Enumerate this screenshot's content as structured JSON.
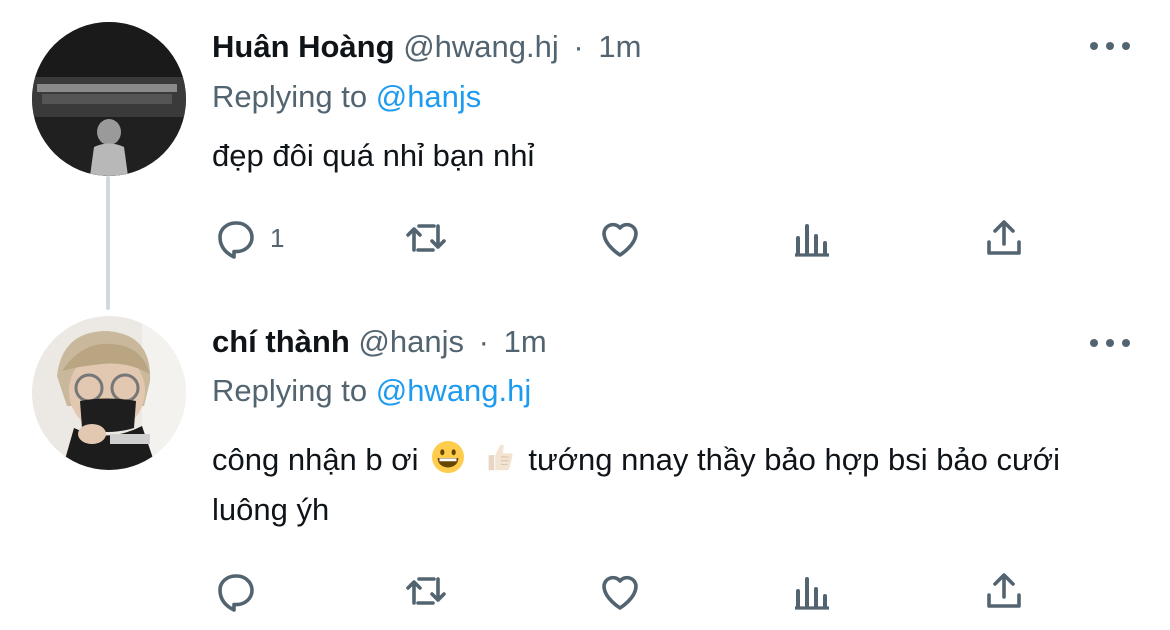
{
  "tweets": [
    {
      "name": "Huân Hoàng",
      "handle": "@hwang.hj",
      "separator": "·",
      "time": "1m",
      "replying_prefix": "Replying to",
      "replying_to": "@hanjs",
      "text": "đẹp đôi quá nhỉ bạn nhỉ",
      "reply_count": "1"
    },
    {
      "name": "chí thành",
      "handle": "@hanjs",
      "separator": "·",
      "time": "1m",
      "replying_prefix": "Replying to",
      "replying_to": "@hwang.hj",
      "text_before_emoji": "công nhận b ơi",
      "emojis": [
        "grinning-face-emoji",
        "thumbs-up-emoji"
      ],
      "text_after_emoji": "tướng nnay thầy bảo hợp bsi bảo cưới luông ýh",
      "reply_count": ""
    }
  ],
  "colors": {
    "text_primary": "#0f1419",
    "text_secondary": "#536471",
    "link": "#1d9bf0",
    "thread_line": "#cfd9de"
  }
}
